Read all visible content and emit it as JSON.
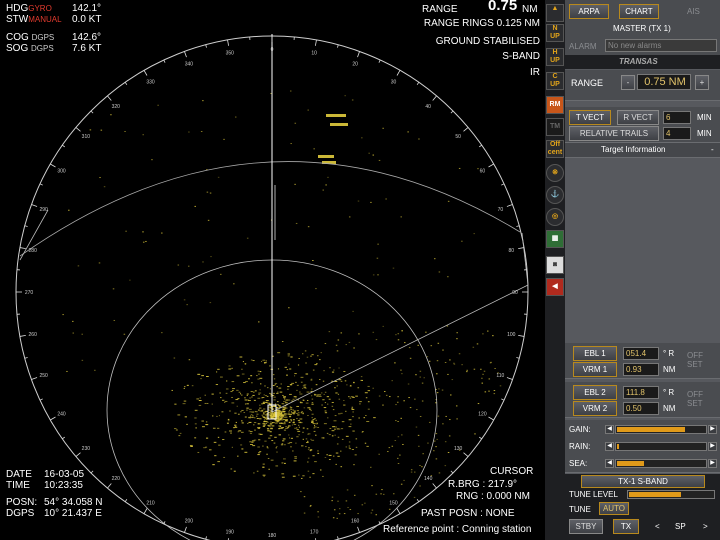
{
  "overlay": {
    "hdg_label": "HDG",
    "hdg_src": "GYRO",
    "hdg_value": "142.1°",
    "stw_label": "STW",
    "stw_src": "MANUAL",
    "stw_value": "0.0 KT",
    "cog_label": "COG",
    "cog_src": "DGPS",
    "cog_value": "142.6°",
    "sog_label": "SOG",
    "sog_src": "DGPS",
    "sog_value": "7.6 KT",
    "range_label": "RANGE",
    "range_value": "0.75",
    "range_unit": "NM",
    "rings": "RANGE RINGS 0.125 NM",
    "stab": "GROUND STABILISED",
    "band": "S-BAND",
    "ir": "IR",
    "date_label": "DATE",
    "date_value": "16-03-05",
    "time_label": "TIME",
    "time_value": "10:23:35",
    "posn_label": "POSN:",
    "posn_lat": "54° 34.058 N",
    "dgps_label": "DGPS",
    "posn_lon": "10° 21.437 E",
    "cursor_title": "CURSOR",
    "rbrg": "R.BRG : 217.9°",
    "rng": "RNG : 0.000 NM",
    "past_posn": "PAST POSN : NONE",
    "ref_point": "Reference point : Conning station"
  },
  "bearing_labels": [
    "0",
    "10",
    "20",
    "30",
    "40",
    "50",
    "60",
    "70",
    "80",
    "90",
    "100",
    "110",
    "120",
    "130",
    "140",
    "150",
    "160",
    "170",
    "180",
    "190",
    "200",
    "210",
    "220",
    "230",
    "240",
    "250",
    "260",
    "270",
    "280",
    "290",
    "300",
    "310",
    "320",
    "330",
    "340",
    "350"
  ],
  "iconbar": {
    "n_up": "N UP",
    "h_up": "H UP",
    "c_up": "C UP",
    "rm": "RM",
    "tm": "TM",
    "off_centre": "Off cent"
  },
  "panel": {
    "arpa": "ARPA",
    "chart": "CHART",
    "ais": "AIS",
    "master": "MASTER (TX 1)",
    "alarm_label": "ALARM",
    "alarm_value": "No new alarms",
    "brand": "TRANSAS",
    "range_label": "RANGE",
    "range_minus": "-",
    "range_value": "0.75 NM",
    "range_plus": "+",
    "tvect": "T VECT",
    "rvect": "R VECT",
    "vect_value": "6",
    "vect_unit": "MIN",
    "trails": "RELATIVE TRAILS",
    "trails_value": "4",
    "trails_unit": "MIN",
    "target_info": "Target Information",
    "target_info_toggle": "-",
    "ebl1": "EBL 1",
    "ebl1_value": "051.4",
    "ebl1_unit": "° R",
    "vrm1": "VRM 1",
    "vrm1_value": "0.93",
    "vrm1_unit": "NM",
    "ebl2": "EBL 2",
    "ebl2_value": "111.8",
    "ebl2_unit": "° R",
    "vrm2": "VRM 2",
    "vrm2_value": "0.50",
    "vrm2_unit": "NM",
    "offset": "OFF SET",
    "gain_label": "GAIN:",
    "gain_level": 0.75,
    "rain_label": "RAIN:",
    "rain_level": 0.02,
    "sea_label": "SEA:",
    "sea_level": 0.3,
    "tx_band": "TX-1 S-BAND",
    "tune_level_label": "TUNE LEVEL",
    "tune_level": 0.6,
    "tune_label": "TUNE",
    "tune_mode": "AUTO",
    "stby": "STBY",
    "tx": "TX",
    "sp": "SP",
    "left_arrow": "<",
    "right_arrow": ">"
  },
  "colors": {
    "echo": "#d6c23a",
    "accent": "#e09a1a",
    "panel": "#57595e",
    "warning": "#c8561a"
  }
}
